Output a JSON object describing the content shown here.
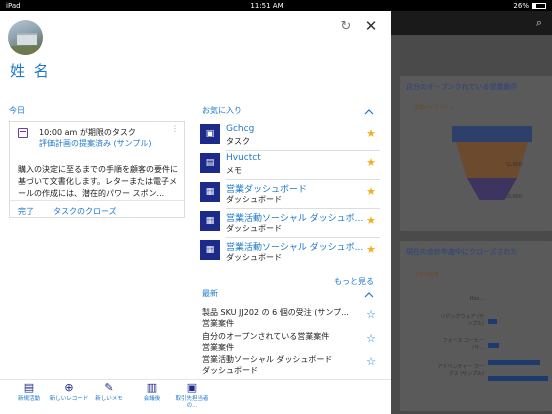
{
  "status_bar": {
    "device": "iPad",
    "time": "11:51 AM",
    "battery": "26%"
  },
  "background_app": {
    "card1_title": "自分のオープンされている営業案件",
    "card1_sub": "営業パイプライン",
    "funnel_labels": [
      "\\2,000",
      "\\3,000"
    ],
    "card2_title": "現在の会計年度中にクローズされた",
    "card2_sub": "上位の顧客",
    "hbar_labels": [
      "Hos...",
      "リビングウェア (サンプル)",
      "フォース コーヒー (サ...",
      "アドベンチャー ワークス (サンプル)"
    ],
    "axis_label": "顧客"
  },
  "panel": {
    "name": "姓 名",
    "today_label": "今日",
    "favorites_label": "お気に入り",
    "recent_label": "最新",
    "more_label": "もっと見る"
  },
  "task": {
    "time_line": "10:00 am が期限のタスク",
    "link": "評価計画の提案済み (サンプル)",
    "description": "購入の決定に至るまでの手順を顧客の要件に基づいて文書化します。レターまたは電子メールの作成には、潜在的パワー スポン...",
    "complete": "完了",
    "close": "タスクのクローズ"
  },
  "favorites": [
    {
      "title": "Gchcg",
      "type": "タスク",
      "icon": "task-icon"
    },
    {
      "title": "Hvuctct",
      "type": "メモ",
      "icon": "memo-icon"
    },
    {
      "title": "営業ダッシュボード",
      "type": "ダッシュボード",
      "icon": "dashboard-icon"
    },
    {
      "title": "営業活動ソーシャル ダッシュボ...",
      "type": "ダッシュボード",
      "icon": "dashboard-icon"
    },
    {
      "title": "営業活動ソーシャル ダッシュボ...",
      "type": "ダッシュボード",
      "icon": "dashboard-icon"
    }
  ],
  "recent": [
    {
      "title": "製品 SKU JJ202 の 6 個の受注 (サンプ...",
      "type": "営業案件"
    },
    {
      "title": "自分のオープンされている営業案件",
      "type": "営業案件"
    },
    {
      "title": "営業活動ソーシャル ダッシュボード",
      "type": "ダッシュボード"
    }
  ],
  "bottom_bar": [
    {
      "label": "新規活動",
      "icon": "new-activity-icon"
    },
    {
      "label": "新しいレコード",
      "icon": "new-record-icon"
    },
    {
      "label": "新しいメモ",
      "icon": "new-note-icon"
    },
    {
      "label": "会議後",
      "icon": "after-meeting-icon"
    },
    {
      "label": "取引先担当者の...",
      "icon": "contact-icon"
    }
  ]
}
